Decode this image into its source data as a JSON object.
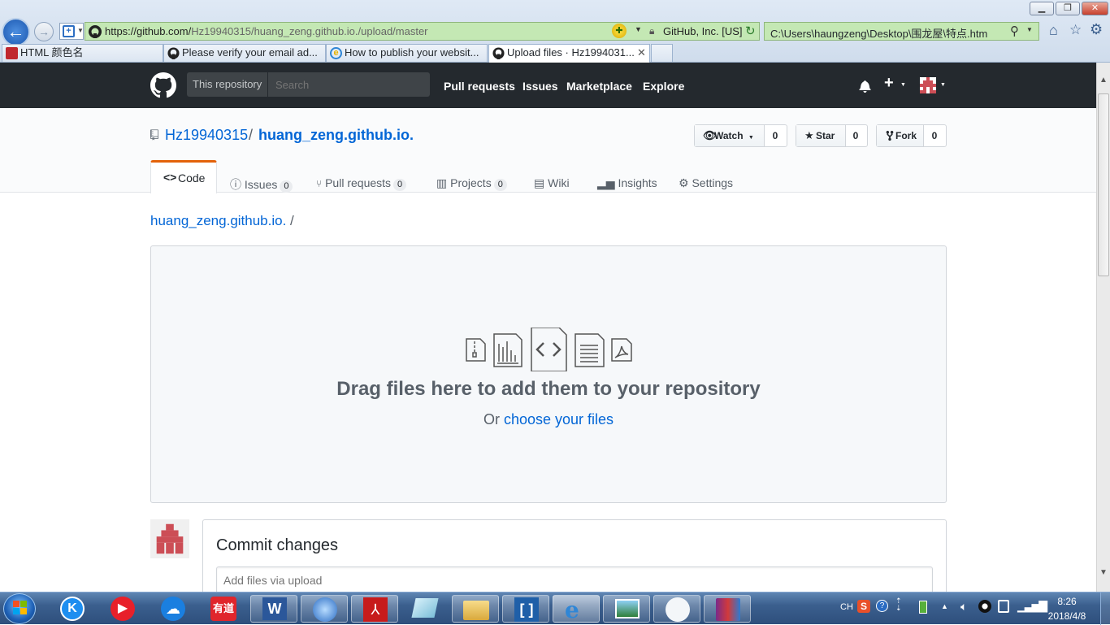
{
  "browser": {
    "url_host": "https://github.com/",
    "url_path": "Hz19940315/huang_zeng.github.io./upload/master",
    "cert": "GitHub, Inc. [US]",
    "search_value": "C:\\Users\\haungzeng\\Desktop\\围龙屋\\特点.htm",
    "tabs": [
      {
        "label": "HTML 颜色名"
      },
      {
        "label": "Please verify your email ad..."
      },
      {
        "label": "How to publish your websit..."
      },
      {
        "label": "Upload files · Hz1994031..."
      }
    ]
  },
  "header": {
    "scope": "This repository",
    "search_placeholder": "Search",
    "nav": [
      "Pull requests",
      "Issues",
      "Marketplace",
      "Explore"
    ]
  },
  "repo": {
    "owner": "Hz19940315",
    "sep": "/",
    "name": "huang_zeng.github.io.",
    "watch": {
      "label": "Watch",
      "count": "0"
    },
    "star": {
      "label": "Star",
      "count": "0"
    },
    "fork": {
      "label": "Fork",
      "count": "0"
    },
    "tabs": [
      {
        "label": "Code"
      },
      {
        "label": "Issues",
        "count": "0"
      },
      {
        "label": "Pull requests",
        "count": "0"
      },
      {
        "label": "Projects",
        "count": "0"
      },
      {
        "label": "Wiki"
      },
      {
        "label": "Insights"
      },
      {
        "label": "Settings"
      }
    ]
  },
  "breadcrumb": {
    "repo": "huang_zeng.github.io.",
    "sep": "/"
  },
  "upload": {
    "heading": "Drag files here to add them to your repository",
    "or": "Or",
    "choose": "choose your files"
  },
  "commit": {
    "title": "Commit changes",
    "placeholder": "Add files via upload"
  },
  "taskbar": {
    "lang": "CH",
    "time": "8:26",
    "date": "2018/4/8"
  },
  "colors": {
    "header_bg": "#24292e",
    "link": "#0366d6",
    "active_tab_border": "#e36209",
    "address_bar": "#c4e8b4"
  }
}
